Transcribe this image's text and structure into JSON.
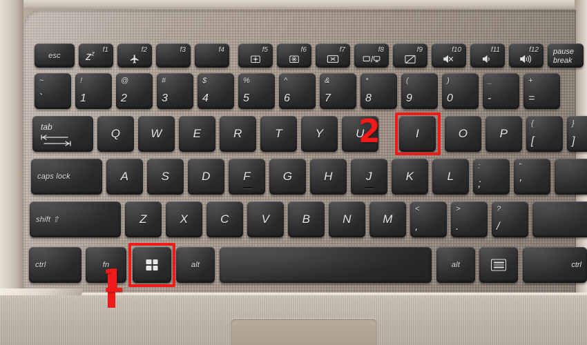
{
  "scene": {
    "device": "laptop keyboard",
    "description": "ASUS laptop keyboard photo with red annotations showing the Windows + I shortcut",
    "deck_color": "#a3968a",
    "key_color": "#2c2c2e",
    "annotation_color": "#f01a1a"
  },
  "annotations": [
    {
      "id": "1",
      "label": "1",
      "target": "windows-key"
    },
    {
      "id": "2",
      "label": "2",
      "target": "i-key"
    }
  ],
  "rows": {
    "function_row": [
      {
        "name": "esc",
        "word": "esc"
      },
      {
        "name": "f1",
        "fn": "f1",
        "glyph": "z-sleep"
      },
      {
        "name": "f2",
        "fn": "f2",
        "glyph": "airplane"
      },
      {
        "name": "f3",
        "fn": "f3",
        "glyph": "none"
      },
      {
        "name": "f4",
        "fn": "f4",
        "glyph": "none"
      },
      {
        "name": "f5",
        "fn": "f5",
        "glyph": "brightness-down"
      },
      {
        "name": "f6",
        "fn": "f6",
        "glyph": "brightness-up"
      },
      {
        "name": "f7",
        "fn": "f7",
        "glyph": "display-off"
      },
      {
        "name": "f8",
        "fn": "f8",
        "glyph": "switch-display"
      },
      {
        "name": "f9",
        "fn": "f9",
        "glyph": "touchpad-toggle"
      },
      {
        "name": "f10",
        "fn": "f10",
        "glyph": "volume-mute"
      },
      {
        "name": "f11",
        "fn": "f11",
        "glyph": "volume-down"
      },
      {
        "name": "f12",
        "fn": "f12",
        "glyph": "volume-up"
      },
      {
        "name": "pause",
        "word2": [
          "pause",
          "break"
        ]
      }
    ],
    "number_row": [
      {
        "name": "grave",
        "top": "~",
        "bottom": "`"
      },
      {
        "name": "1",
        "top": "!",
        "bottom": "1"
      },
      {
        "name": "2",
        "top": "@",
        "bottom": "2"
      },
      {
        "name": "3",
        "top": "#",
        "bottom": "3"
      },
      {
        "name": "4",
        "top": "$",
        "bottom": "4"
      },
      {
        "name": "5",
        "top": "%",
        "bottom": "5"
      },
      {
        "name": "6",
        "top": "^",
        "bottom": "6"
      },
      {
        "name": "7",
        "top": "&",
        "bottom": "7"
      },
      {
        "name": "8",
        "top": "*",
        "bottom": "8"
      },
      {
        "name": "9",
        "top": "(",
        "bottom": "9"
      },
      {
        "name": "0",
        "top": ")",
        "bottom": "0"
      },
      {
        "name": "minus",
        "top": "_",
        "bottom": "-"
      },
      {
        "name": "equal",
        "top": "+",
        "bottom": "="
      }
    ],
    "qwerty_row": [
      {
        "name": "tab",
        "word": "tab"
      },
      {
        "name": "q",
        "main": "Q"
      },
      {
        "name": "w",
        "main": "W"
      },
      {
        "name": "e",
        "main": "E"
      },
      {
        "name": "r",
        "main": "R"
      },
      {
        "name": "t",
        "main": "T"
      },
      {
        "name": "y",
        "main": "Y"
      },
      {
        "name": "u",
        "main": "U"
      },
      {
        "name": "i",
        "main": "I"
      },
      {
        "name": "o",
        "main": "O"
      },
      {
        "name": "p",
        "main": "P"
      },
      {
        "name": "bracket-left",
        "top": "{",
        "bottom": "["
      },
      {
        "name": "bracket-right",
        "top": "}",
        "bottom": "]"
      }
    ],
    "home_row": [
      {
        "name": "caps-lock",
        "word": "caps lock"
      },
      {
        "name": "a",
        "main": "A"
      },
      {
        "name": "s",
        "main": "S"
      },
      {
        "name": "d",
        "main": "D"
      },
      {
        "name": "f",
        "main": "F",
        "bump": true
      },
      {
        "name": "g",
        "main": "G"
      },
      {
        "name": "h",
        "main": "H"
      },
      {
        "name": "j",
        "main": "J",
        "bump": true
      },
      {
        "name": "k",
        "main": "K"
      },
      {
        "name": "l",
        "main": "L"
      },
      {
        "name": "semicolon",
        "top": ":",
        "bottom": ";"
      },
      {
        "name": "quote",
        "top": "”",
        "bottom": "’"
      }
    ],
    "shift_row": [
      {
        "name": "shift",
        "word": "shift ⇧"
      },
      {
        "name": "z",
        "main": "Z"
      },
      {
        "name": "x",
        "main": "X"
      },
      {
        "name": "c",
        "main": "C"
      },
      {
        "name": "v",
        "main": "V"
      },
      {
        "name": "b",
        "main": "B"
      },
      {
        "name": "n",
        "main": "N"
      },
      {
        "name": "m",
        "main": "M"
      },
      {
        "name": "comma",
        "top": "<",
        "bottom": ","
      },
      {
        "name": "period",
        "top": ">",
        "bottom": "."
      },
      {
        "name": "slash",
        "top": "?",
        "bottom": "/"
      }
    ],
    "bottom_row": [
      {
        "name": "ctrl-left",
        "word": "ctrl"
      },
      {
        "name": "fn",
        "word": "fn"
      },
      {
        "name": "windows",
        "glyph": "windows-logo",
        "highlighted": true
      },
      {
        "name": "alt-left",
        "word": "alt"
      },
      {
        "name": "space",
        "word": ""
      },
      {
        "name": "alt-right",
        "word": "alt"
      },
      {
        "name": "menu",
        "glyph": "menu-icon"
      },
      {
        "name": "ctrl-right",
        "word": "ctrl"
      }
    ]
  }
}
